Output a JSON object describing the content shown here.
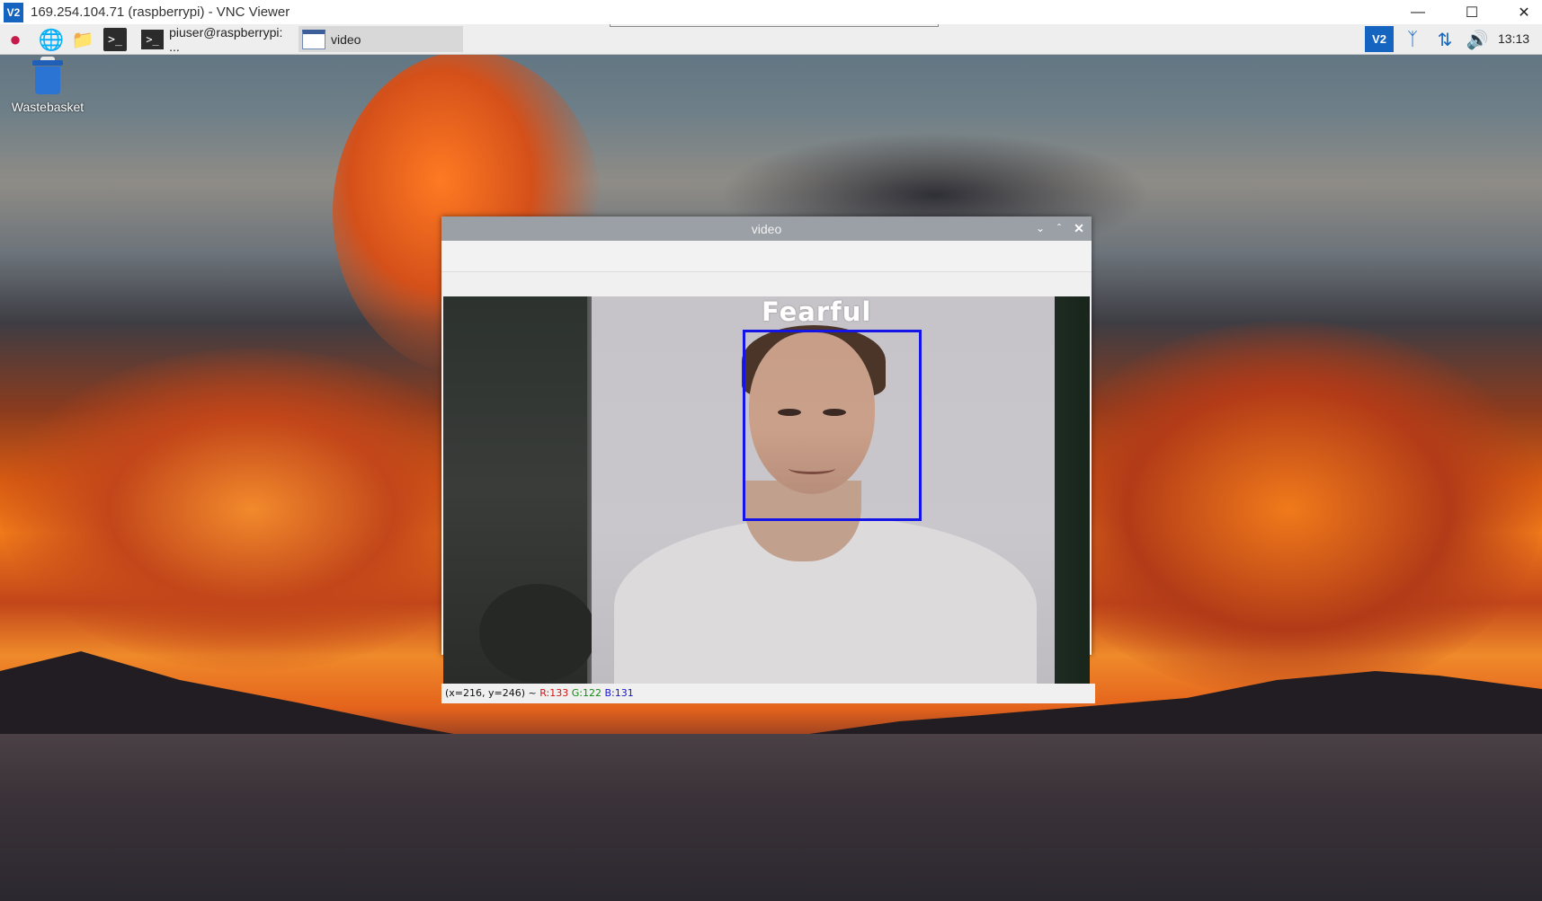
{
  "vnc": {
    "logo": "V2",
    "title": "169.254.104.71 (raspberrypi) - VNC Viewer",
    "minimize_icon": "minimize-icon",
    "maximize_icon": "maximize-icon",
    "close_icon": "close-icon"
  },
  "taskbar": {
    "launchers": [
      "raspberry-menu-icon",
      "web-browser-icon",
      "file-manager-icon",
      "terminal-icon"
    ],
    "tasks": [
      {
        "label": "piuser@raspberrypi: ...",
        "icon": "terminal-icon",
        "icon_text": ">_"
      },
      {
        "label": "video",
        "icon": "window-icon"
      }
    ],
    "tray": {
      "vnc_label": "V2",
      "bluetooth_icon": "bluetooth-icon",
      "network_icon": "network-transfer-icon",
      "volume_icon": "volume-icon",
      "clock": "13:13"
    }
  },
  "desktop": {
    "icons": [
      {
        "label": "Wastebasket",
        "icon": "wastebasket-icon"
      }
    ]
  },
  "video_window": {
    "title": "video",
    "emotion_label": "Fearful",
    "status": {
      "coords": "(x=216, y=246) ~",
      "r": "R:133",
      "g": "G:122",
      "b": "B:131"
    },
    "colors": {
      "face_box": "#1414e6",
      "title_bar": "#9aa0a6"
    }
  },
  "colors": {
    "vnc_accent": "#1565c0",
    "raspberry": "#c51a4a"
  }
}
